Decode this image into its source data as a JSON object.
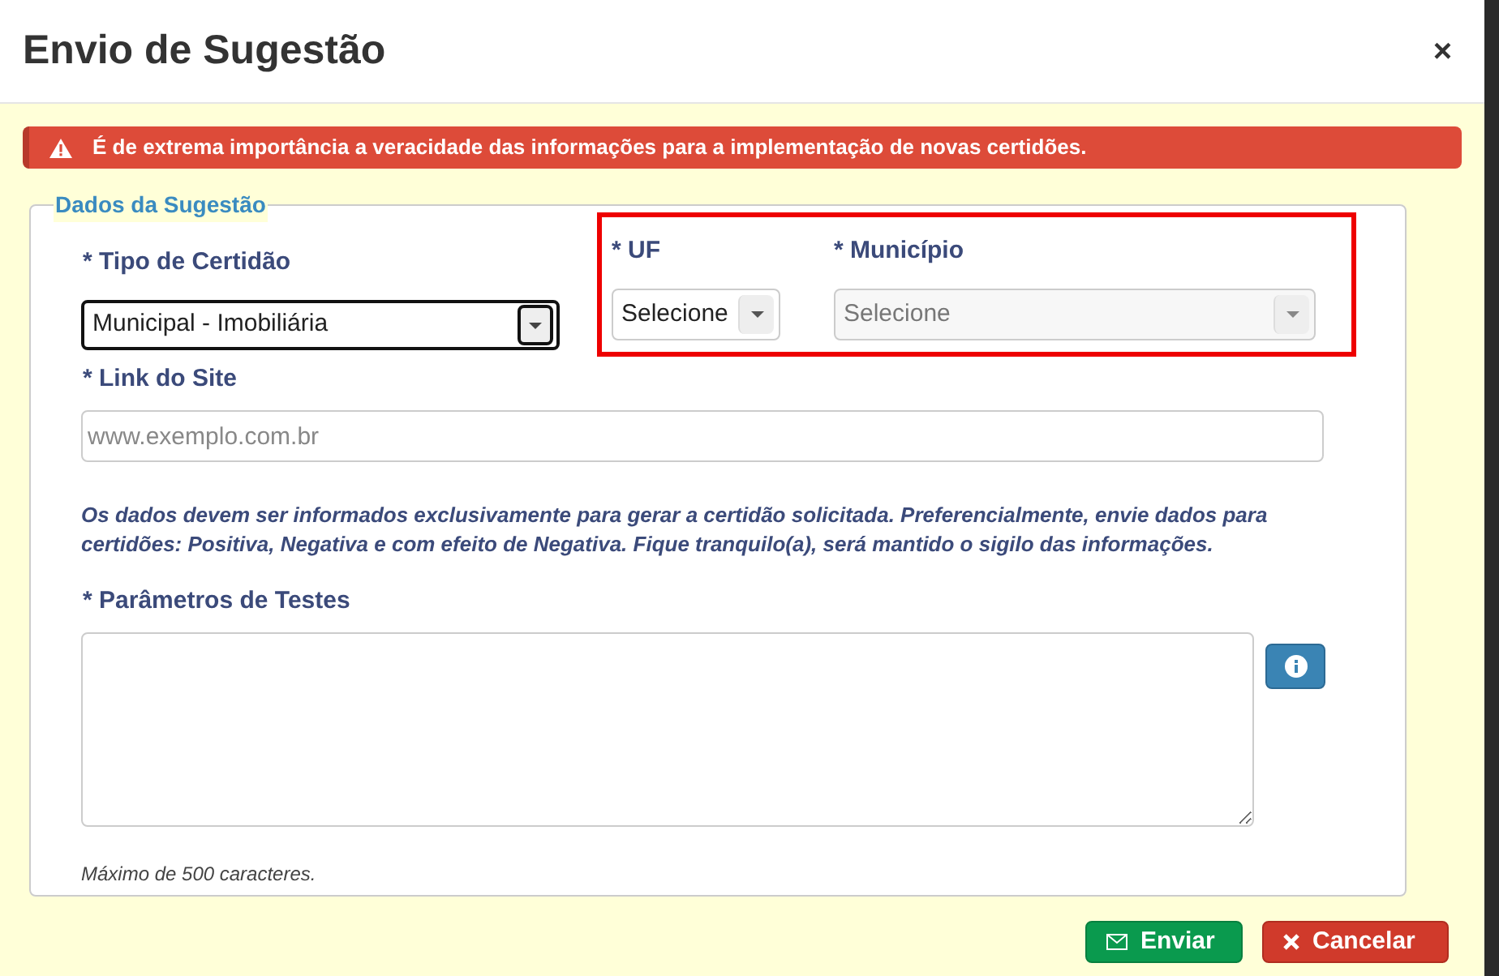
{
  "dialog": {
    "title": "Envio de Sugestão",
    "close": "×"
  },
  "alert": {
    "text": "É de extrema importância a veracidade das informações para a implementação de novas certidões."
  },
  "fieldset": {
    "legend": "Dados da Sugestão",
    "tipo": {
      "label": "* Tipo de Certidão",
      "value": "Municipal - Imobiliária",
      "focused": true
    },
    "highlighted": {
      "uf": {
        "label": "* UF",
        "value": "Selecione",
        "disabled": false
      },
      "municipio": {
        "label": "* Município",
        "value": "Selecione",
        "disabled": true
      }
    },
    "link": {
      "label": "* Link do Site",
      "placeholder": "www.exemplo.com.br"
    },
    "note": "Os dados devem ser informados exclusivamente para gerar a certidão solicitada. Preferencialmente, envie dados para certidões: Positiva, Negativa e com efeito de Negativa. Fique tranquilo(a), será mantido o sigilo das informações.",
    "params": {
      "label": "* Parâmetros de Testes"
    },
    "max_note": "Máximo de 500 caracteres."
  },
  "buttons": [
    {
      "label": "Enviar",
      "kind": "send"
    },
    {
      "label": "Cancelar",
      "kind": "cancel"
    }
  ]
}
